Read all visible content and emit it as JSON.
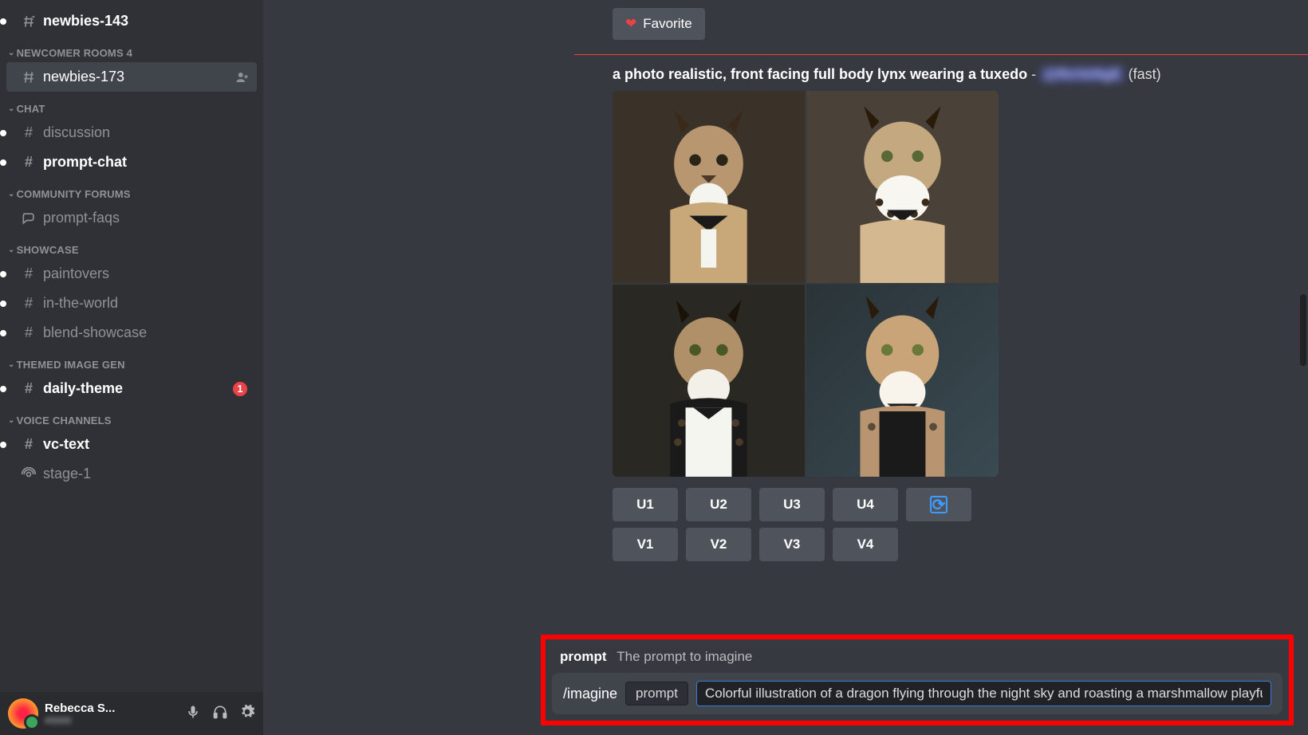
{
  "sidebar": {
    "top_channel": {
      "name": "newbies-143"
    },
    "categories": [
      {
        "label": "NEWCOMER ROOMS 4",
        "items": [
          {
            "name": "newbies-173",
            "active": true,
            "type": "limited"
          }
        ]
      },
      {
        "label": "CHAT",
        "items": [
          {
            "name": "discussion",
            "type": "text",
            "unread": true
          },
          {
            "name": "prompt-chat",
            "type": "text",
            "unread": true,
            "bright": true
          }
        ]
      },
      {
        "label": "COMMUNITY FORUMS",
        "items": [
          {
            "name": "prompt-faqs",
            "type": "forum"
          }
        ]
      },
      {
        "label": "SHOWCASE",
        "items": [
          {
            "name": "paintovers",
            "type": "text",
            "unread": true
          },
          {
            "name": "in-the-world",
            "type": "text",
            "unread": true
          },
          {
            "name": "blend-showcase",
            "type": "text",
            "unread": true
          }
        ]
      },
      {
        "label": "THEMED IMAGE GEN",
        "items": [
          {
            "name": "daily-theme",
            "type": "text",
            "unread": true,
            "bright": true,
            "badge": "1"
          }
        ]
      },
      {
        "label": "VOICE CHANNELS",
        "items": [
          {
            "name": "vc-text",
            "type": "text",
            "unread": true,
            "bright": true
          },
          {
            "name": "stage-1",
            "type": "stage"
          }
        ]
      }
    ],
    "user": {
      "name": "Rebecca S...",
      "tag": "#0000"
    }
  },
  "top_actions": {
    "favorite": "Favorite"
  },
  "message": {
    "prompt_text": "a photo realistic, front facing full body lynx wearing a tuxedo",
    "separator": " - ",
    "mention": "@ReVeNgE",
    "mode": " (fast)",
    "upscale_buttons": [
      "U1",
      "U2",
      "U3",
      "U4"
    ],
    "variation_buttons": [
      "V1",
      "V2",
      "V3",
      "V4"
    ]
  },
  "composer": {
    "hint_key": "prompt",
    "hint_desc": "The prompt to imagine",
    "command": "/imagine",
    "param": "prompt",
    "input_value": "Colorful illustration of a dragon flying through the night sky and roasting a marshmallow playful artstyle"
  }
}
